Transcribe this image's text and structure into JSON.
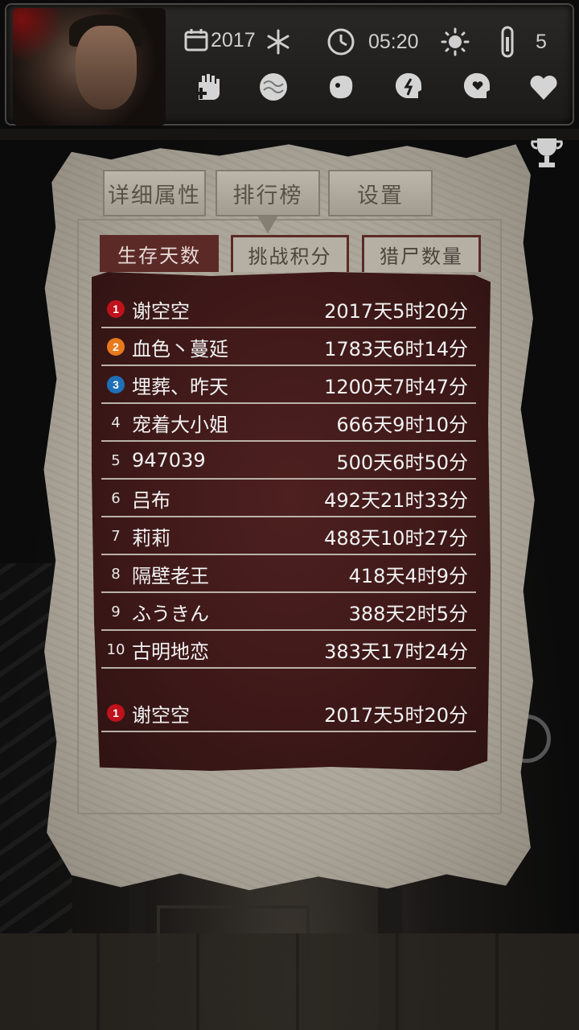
{
  "status": {
    "year": "2017",
    "clock": "05:20",
    "temperature": "5"
  },
  "main_tabs": [
    {
      "label": "详细属性"
    },
    {
      "label": "排行榜"
    },
    {
      "label": "设置"
    }
  ],
  "sub_tabs": [
    {
      "label": "生存天数"
    },
    {
      "label": "挑战积分"
    },
    {
      "label": "猎尸数量"
    }
  ],
  "leaderboard": [
    {
      "rank": "1",
      "name": "谢空空",
      "time": "2017天5时20分"
    },
    {
      "rank": "2",
      "name": "血色丶蔓延",
      "time": "1783天6时14分"
    },
    {
      "rank": "3",
      "name": "埋葬、昨天",
      "time": "1200天7时47分"
    },
    {
      "rank": "4",
      "name": "宠着大小姐",
      "time": "666天9时10分"
    },
    {
      "rank": "5",
      "name": "947039",
      "time": "500天6时50分"
    },
    {
      "rank": "6",
      "name": "吕布",
      "time": "492天21时33分"
    },
    {
      "rank": "7",
      "name": "莉莉",
      "time": "488天10时27分"
    },
    {
      "rank": "8",
      "name": "隔壁老王",
      "time": "418天4时9分"
    },
    {
      "rank": "9",
      "name": "ふうきん",
      "time": "388天2时5分"
    },
    {
      "rank": "10",
      "name": "古明地恋",
      "time": "383天17时24分"
    }
  ],
  "my_rank": {
    "rank": "1",
    "name": "谢空空",
    "time": "2017天5时20分"
  },
  "colors": {
    "medal_gold": "#c0121c",
    "medal_silver": "#e8791c",
    "medal_bronze": "#1e6fb8",
    "board": "#4a1e1e",
    "paper": "#b3ad a1"
  },
  "icons": [
    "calendar-icon",
    "snowflake-icon",
    "clock-icon",
    "sun-icon",
    "thermometer-icon",
    "health-hand-icon",
    "brain-icon",
    "stomach-icon",
    "energy-head-icon",
    "mood-head-icon",
    "heart-icon",
    "trophy-icon"
  ]
}
